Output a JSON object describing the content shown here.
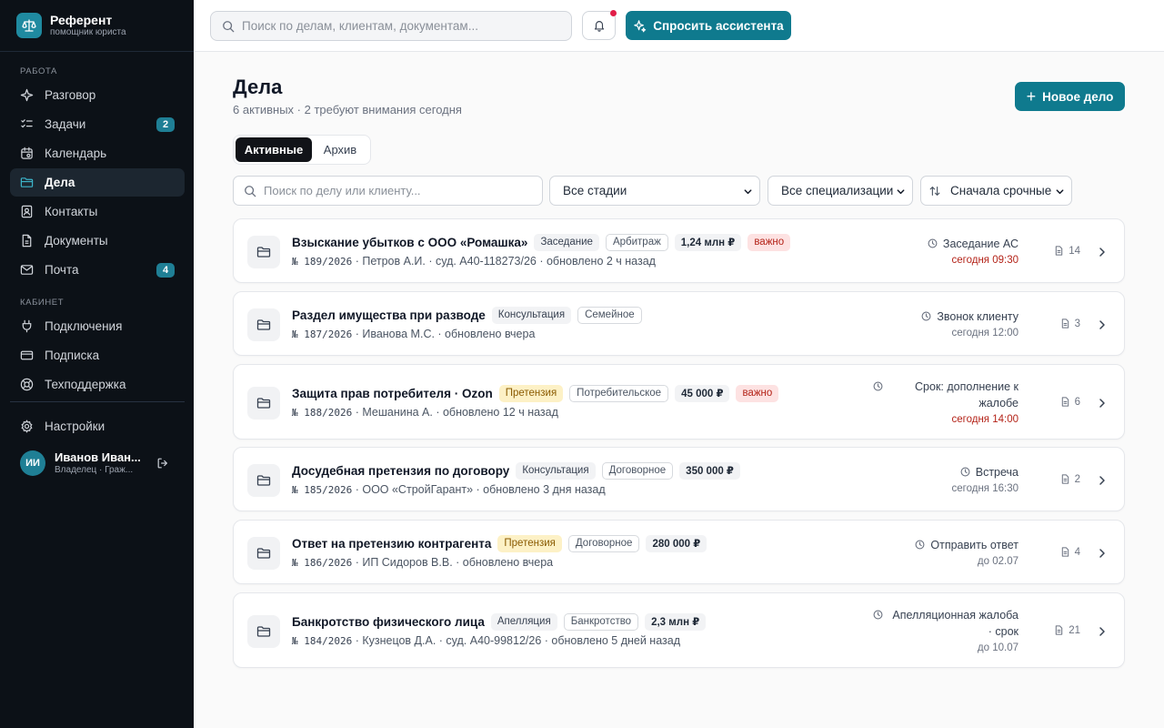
{
  "brand": {
    "title": "Референт",
    "subtitle": "помощник юриста"
  },
  "sidebar": {
    "section_work": "РАБОТА",
    "section_cabinet": "КАБИНЕТ",
    "items": [
      {
        "label": "Разговор",
        "icon": "sparkle-icon"
      },
      {
        "label": "Задачи",
        "icon": "checklist-icon",
        "badge": "2"
      },
      {
        "label": "Календарь",
        "icon": "calendar-icon"
      },
      {
        "label": "Дела",
        "icon": "folder-icon",
        "active": true
      },
      {
        "label": "Контакты",
        "icon": "contacts-icon"
      },
      {
        "label": "Документы",
        "icon": "document-icon"
      },
      {
        "label": "Почта",
        "icon": "mail-icon",
        "badge": "4"
      },
      {
        "label": "Подключения",
        "icon": "plug-icon"
      },
      {
        "label": "Подписка",
        "icon": "card-icon"
      },
      {
        "label": "Техподдержка",
        "icon": "lifebuoy-icon"
      },
      {
        "label": "Настройки",
        "icon": "gear-icon"
      }
    ],
    "user": {
      "initials": "ИИ",
      "name": "Иванов Иван...",
      "role": "Владелец · Граж..."
    }
  },
  "topbar": {
    "search_placeholder": "Поиск по делам, клиентам, документам...",
    "ask_label": "Спросить ассистента"
  },
  "main": {
    "title": "Дела",
    "subtitle": "6 активных · 2 требуют внимания сегодня",
    "new_button": "Новое дело",
    "tabs": [
      {
        "label": "Активные",
        "active": true
      },
      {
        "label": "Архив"
      }
    ],
    "filter_search_placeholder": "Поиск по делу или клиенту...",
    "stage_filter": "Все стадии",
    "spec_filter": "Все специализации",
    "sort_filter": "Сначала срочные"
  },
  "cases": [
    {
      "title": "Взыскание убытков с ООО «Ромашка»",
      "stage": "Заседание",
      "stage_warn": false,
      "spec": "Арбитраж",
      "amount": "1,24 млн ₽",
      "important": "важно",
      "num": "№ 189/2026",
      "meta": " · Петров А.И. · суд. А40-118273/26 · обновлено 2 ч назад",
      "event": "Заседание АС",
      "event_time": "сегодня 09:30",
      "urgent": true,
      "docs": "14"
    },
    {
      "title": "Раздел имущества при разводе",
      "stage": "Консультация",
      "stage_warn": false,
      "spec": "Семейное",
      "amount": "",
      "important": "",
      "num": "№ 187/2026",
      "meta": " · Иванова М.С. · обновлено вчера",
      "event": "Звонок клиенту",
      "event_time": "сегодня 12:00",
      "urgent": false,
      "docs": "3"
    },
    {
      "title": "Защита прав потребителя · Ozon",
      "stage": "Претензия",
      "stage_warn": true,
      "spec": "Потребительское",
      "amount": "45 000 ₽",
      "important": "важно",
      "num": "№ 188/2026",
      "meta": " · Мешанина А. · обновлено 12 ч назад",
      "event": "Срок: дополнение к жалобе",
      "event_time": "сегодня 14:00",
      "urgent": true,
      "docs": "6"
    },
    {
      "title": "Досудебная претензия по договору",
      "stage": "Консультация",
      "stage_warn": false,
      "spec": "Договорное",
      "amount": "350 000 ₽",
      "important": "",
      "num": "№ 185/2026",
      "meta": " · ООО «СтройГарант» · обновлено 3 дня назад",
      "event": "Встреча",
      "event_time": "сегодня 16:30",
      "urgent": false,
      "docs": "2"
    },
    {
      "title": "Ответ на претензию контрагента",
      "stage": "Претензия",
      "stage_warn": true,
      "spec": "Договорное",
      "amount": "280 000 ₽",
      "important": "",
      "num": "№ 186/2026",
      "meta": " · ИП Сидоров В.В. · обновлено вчера",
      "event": "Отправить ответ",
      "event_time": "до 02.07",
      "urgent": false,
      "docs": "4"
    },
    {
      "title": "Банкротство физического лица",
      "stage": "Апелляция",
      "stage_warn": false,
      "spec": "Банкротство",
      "amount": "2,3 млн ₽",
      "important": "",
      "num": "№ 184/2026",
      "meta": " · Кузнецов Д.А. · суд. А40-99812/26 · обновлено 5 дней назад",
      "event": "Апелляционная жалоба · срок",
      "event_time": "до 10.07",
      "urgent": false,
      "docs": "21"
    }
  ]
}
